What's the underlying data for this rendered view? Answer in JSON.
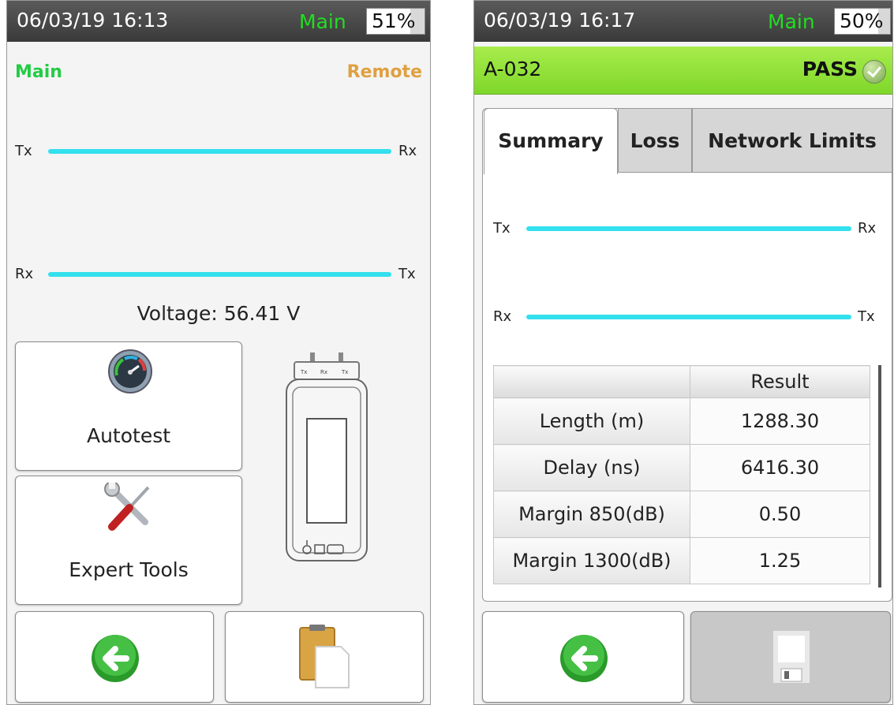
{
  "left_screen": {
    "status": {
      "time": "06/03/19 16:13",
      "mode": "Main",
      "battery": "51%",
      "battery_fraction": 0.51
    },
    "ends": {
      "local": "Main",
      "remote": "Remote"
    },
    "fibers": [
      {
        "left": "Tx",
        "right": "Rx"
      },
      {
        "left": "Rx",
        "right": "Tx"
      }
    ],
    "voltage": "Voltage: 56.41 V",
    "buttons": {
      "autotest": "Autotest",
      "expert_tools": "Expert Tools"
    },
    "icons": {
      "autotest": "gauge-icon",
      "expert_tools": "wrench-screwdriver-icon",
      "device": "tester-device-icon",
      "back": "back-arrow-icon",
      "clipboard": "clipboard-icon"
    },
    "device_port_labels": [
      "Tx",
      "Rx",
      "Tx"
    ]
  },
  "right_screen": {
    "status": {
      "time": "06/03/19 16:17",
      "mode": "Main",
      "battery": "50%",
      "battery_fraction": 0.5
    },
    "result_bar": {
      "id": "A-032",
      "status": "PASS"
    },
    "tabs": [
      "Summary",
      "Loss",
      "Network Limits"
    ],
    "active_tab": "Summary",
    "fibers": [
      {
        "left": "Tx",
        "right": "Rx"
      },
      {
        "left": "Rx",
        "right": "Tx"
      }
    ],
    "table": {
      "header": [
        "",
        "Result"
      ],
      "rows": [
        {
          "label": "Length (m)",
          "value": "1288.30"
        },
        {
          "label": "Delay (ns)",
          "value": "6416.30"
        },
        {
          "label": "Margin 850(dB)",
          "value": "0.50"
        },
        {
          "label": "Margin 1300(dB)",
          "value": "1.25"
        }
      ]
    },
    "icons": {
      "back": "back-arrow-icon",
      "save": "save-icon",
      "pass": "check-icon"
    }
  },
  "colors": {
    "fiber": "#33e0ee",
    "main": "#22dd22",
    "remote": "#e0a040",
    "pass": "#8ede3a"
  }
}
